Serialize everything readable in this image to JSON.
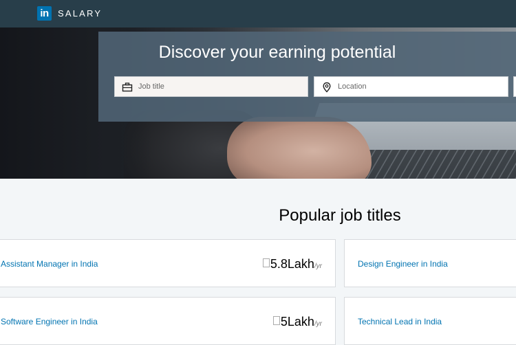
{
  "header": {
    "logo_text": "in",
    "brand": "SALARY"
  },
  "hero": {
    "headline": "Discover your earning potential",
    "job_placeholder": "Job title",
    "location_placeholder": "Location"
  },
  "popular": {
    "title": "Popular job titles",
    "cards": [
      {
        "title": "Assistant Manager in India",
        "amount": "5.8Lakh",
        "unit": "/yr"
      },
      {
        "title": "Design Engineer in India"
      },
      {
        "title": "Software Engineer in India",
        "amount": "5Lakh",
        "unit": "/yr"
      },
      {
        "title": "Technical Lead in India"
      }
    ]
  },
  "colors": {
    "topbar": "#283e4a",
    "brand_blue": "#0073b1",
    "overlay": "#516576"
  }
}
